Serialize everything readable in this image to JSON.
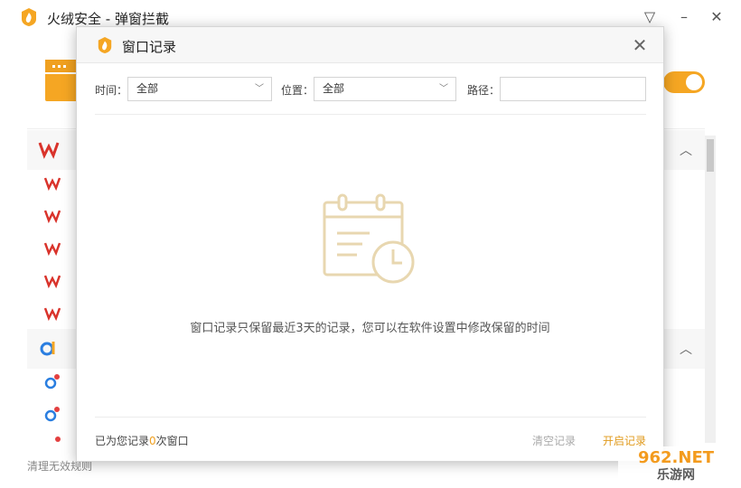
{
  "app": {
    "title": "火绒安全 - 弹窗拦截",
    "footer_link": "清理无效规则"
  },
  "colors": {
    "accent": "#f5a623",
    "link_accent": "#e09a1c",
    "wps_red": "#d9332b"
  },
  "dialog": {
    "title": "窗口记录",
    "filters": {
      "time_label": "时间：",
      "time_value": "全部",
      "position_label": "位置：",
      "position_value": "全部",
      "path_label": "路径：",
      "path_value": ""
    },
    "empty_message": "窗口记录只保留最近3天的记录，您可以在软件设置中修改保留的时间",
    "footer": {
      "count_prefix": "已为您记录",
      "count": "0",
      "count_suffix": "次窗口",
      "clear_label": "清空记录",
      "enable_label": "开启记录"
    }
  },
  "watermark": {
    "line1": "962.NET",
    "line2": "乐游网"
  }
}
